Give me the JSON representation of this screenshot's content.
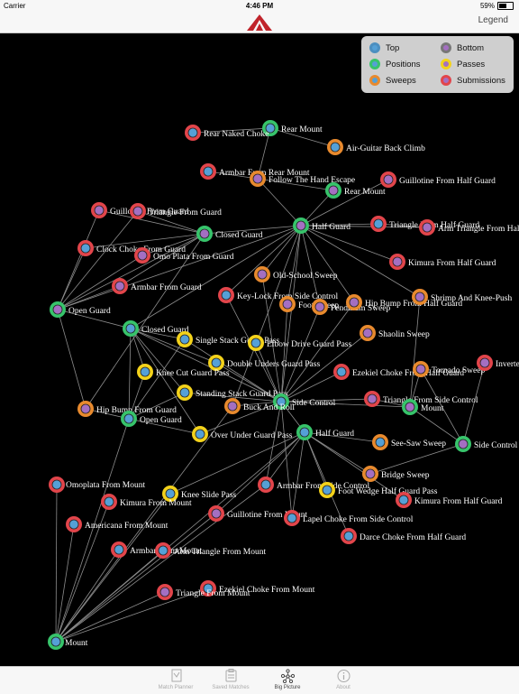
{
  "status_bar": {
    "carrier": "Carrier",
    "time": "4:46 PM",
    "battery": "59%",
    "battery_level": 0.59
  },
  "nav_bar": {
    "legend_label": "Legend"
  },
  "legend": {
    "items": [
      {
        "label": "Top",
        "fill": "#55a0d6",
        "ring": "#4c8fc0"
      },
      {
        "label": "Bottom",
        "fill": "#a46fc2",
        "ring": "#777"
      },
      {
        "label": "Positions",
        "fill": "#55a0d6",
        "ring": "#37c46b"
      },
      {
        "label": "Passes",
        "fill": "#a46fc2",
        "ring": "#f3d21b"
      },
      {
        "label": "Sweeps",
        "fill": "#55a0d6",
        "ring": "#e88a2e"
      },
      {
        "label": "Submissions",
        "fill": "#a46fc2",
        "ring": "#e2454b"
      }
    ]
  },
  "colors": {
    "top": "#55a0d6",
    "bottom": "#a46fc2",
    "positions": "#37c46b",
    "passes": "#f3d21b",
    "sweeps": "#e88a2e",
    "submissions": "#e2454b",
    "edge": "#8d8d8d",
    "accent": "#c0242b"
  },
  "tabs": [
    {
      "label": "Match Planner",
      "icon": "match-planner-icon"
    },
    {
      "label": "Saved Matches",
      "icon": "saved-matches-icon"
    },
    {
      "label": "Big Picture",
      "icon": "big-picture-icon",
      "active": true
    },
    {
      "label": "About",
      "icon": "about-icon"
    }
  ],
  "graph": {
    "nodes": [
      {
        "id": "n01",
        "label": "Rear Mount",
        "kind": "positions",
        "side": "top"
      },
      {
        "id": "n02",
        "label": "Rear Naked Choke",
        "kind": "submissions",
        "side": "top"
      },
      {
        "id": "n03",
        "label": "Air-Guitar Back Climb",
        "kind": "sweeps",
        "side": "top"
      },
      {
        "id": "n04",
        "label": "Armbar From Rear Mount",
        "kind": "submissions",
        "side": "top"
      },
      {
        "id": "n05",
        "label": "Follow The Hand Escape",
        "kind": "sweeps",
        "side": "bottom"
      },
      {
        "id": "n06",
        "label": "Guillotine From Half Guard",
        "kind": "submissions",
        "side": "bottom"
      },
      {
        "id": "n07",
        "label": "Rear Mount",
        "kind": "positions",
        "side": "bottom"
      },
      {
        "id": "n08",
        "label": "Guillotine From Guard",
        "kind": "submissions",
        "side": "bottom"
      },
      {
        "id": "n09",
        "label": "Triangle From Guard",
        "kind": "submissions",
        "side": "bottom"
      },
      {
        "id": "n10",
        "label": "Closed Guard",
        "kind": "positions",
        "side": "bottom"
      },
      {
        "id": "n11",
        "label": "Half Guard",
        "kind": "positions",
        "side": "bottom"
      },
      {
        "id": "n12",
        "label": "Triangle From Half Guard",
        "kind": "submissions",
        "side": "top"
      },
      {
        "id": "n13",
        "label": "Arm Triangle From Half Guard",
        "kind": "submissions",
        "side": "bottom"
      },
      {
        "id": "n14",
        "label": "Clock Choke From Guard",
        "kind": "submissions",
        "side": "top"
      },
      {
        "id": "n15",
        "label": "Omo Plata From Guard",
        "kind": "submissions",
        "side": "bottom"
      },
      {
        "id": "n16",
        "label": "Kimura From Half Guard",
        "kind": "submissions",
        "side": "bottom"
      },
      {
        "id": "n17",
        "label": "Old-School Sweep",
        "kind": "sweeps",
        "side": "bottom"
      },
      {
        "id": "n18",
        "label": "Armbar From Guard",
        "kind": "submissions",
        "side": "bottom"
      },
      {
        "id": "n19",
        "label": "Key-Lock From Side Control",
        "kind": "submissions",
        "side": "top"
      },
      {
        "id": "n20",
        "label": "Foot Sweep",
        "kind": "sweeps",
        "side": "bottom"
      },
      {
        "id": "n21",
        "label": "Pendulum Sweep",
        "kind": "sweeps",
        "side": "bottom"
      },
      {
        "id": "n22",
        "label": "Hip Bump From Half Guard",
        "kind": "sweeps",
        "side": "bottom"
      },
      {
        "id": "n23",
        "label": "Shrimp And Knee-Push",
        "kind": "sweeps",
        "side": "bottom"
      },
      {
        "id": "n24",
        "label": "Open Guard",
        "kind": "positions",
        "side": "bottom"
      },
      {
        "id": "n25",
        "label": "Closed Guard",
        "kind": "positions",
        "side": "top"
      },
      {
        "id": "n26",
        "label": "Single Stack Guard Pass",
        "kind": "passes",
        "side": "top"
      },
      {
        "id": "n27",
        "label": "Elbow Drive Guard Pass",
        "kind": "passes",
        "side": "top"
      },
      {
        "id": "n28",
        "label": "Shaolin Sweep",
        "kind": "sweeps",
        "side": "bottom"
      },
      {
        "id": "n29",
        "label": "Double Unders Guard Pass",
        "kind": "passes",
        "side": "top"
      },
      {
        "id": "n30",
        "label": "Knee Cut Guard Pass",
        "kind": "passes",
        "side": "top"
      },
      {
        "id": "n31",
        "label": "Ezekiel Choke From Half Guard",
        "kind": "submissions",
        "side": "top"
      },
      {
        "id": "n32",
        "label": "Tornado Sweep",
        "kind": "sweeps",
        "side": "bottom"
      },
      {
        "id": "n33",
        "label": "Inverted Triangle",
        "kind": "submissions",
        "side": "bottom"
      },
      {
        "id": "n34",
        "label": "Standing Stack Guard Pass",
        "kind": "passes",
        "side": "top"
      },
      {
        "id": "n35",
        "label": "Side Control",
        "kind": "positions",
        "side": "top"
      },
      {
        "id": "n36",
        "label": "Triangle From Side Control",
        "kind": "submissions",
        "side": "bottom"
      },
      {
        "id": "n37",
        "label": "Hip Bump From Guard",
        "kind": "sweeps",
        "side": "bottom"
      },
      {
        "id": "n38",
        "label": "Buck And Roll",
        "kind": "sweeps",
        "side": "bottom"
      },
      {
        "id": "n39",
        "label": "Mount",
        "kind": "positions",
        "side": "bottom"
      },
      {
        "id": "n40",
        "label": "Open Guard",
        "kind": "positions",
        "side": "top"
      },
      {
        "id": "n41",
        "label": "Over Under Guard Pass",
        "kind": "passes",
        "side": "top"
      },
      {
        "id": "n42",
        "label": "Half Guard",
        "kind": "positions",
        "side": "top"
      },
      {
        "id": "n43",
        "label": "See-Saw Sweep",
        "kind": "sweeps",
        "side": "top"
      },
      {
        "id": "n44",
        "label": "Side Control",
        "kind": "positions",
        "side": "bottom"
      },
      {
        "id": "n45",
        "label": "Armbar From Side Control",
        "kind": "submissions",
        "side": "top"
      },
      {
        "id": "n46",
        "label": "Bridge Sweep",
        "kind": "sweeps",
        "side": "bottom"
      },
      {
        "id": "n47",
        "label": "Omoplata From Mount",
        "kind": "submissions",
        "side": "top"
      },
      {
        "id": "n48",
        "label": "Knee Slide Pass",
        "kind": "passes",
        "side": "top"
      },
      {
        "id": "n49",
        "label": "Foot Wedge Half Guard Pass",
        "kind": "passes",
        "side": "top"
      },
      {
        "id": "n50",
        "label": "Kimura From Half Guard",
        "kind": "submissions",
        "side": "top"
      },
      {
        "id": "n51",
        "label": "Kimura From Mount",
        "kind": "submissions",
        "side": "top"
      },
      {
        "id": "n52",
        "label": "Guillotine From Mount",
        "kind": "submissions",
        "side": "bottom"
      },
      {
        "id": "n53",
        "label": "Lapel Choke From Side Control",
        "kind": "submissions",
        "side": "top"
      },
      {
        "id": "n54",
        "label": "Americana From Mount",
        "kind": "submissions",
        "side": "top"
      },
      {
        "id": "n55",
        "label": "Darce Choke From Half Guard",
        "kind": "submissions",
        "side": "top"
      },
      {
        "id": "n56",
        "label": "Armbar From Mount",
        "kind": "submissions",
        "side": "top"
      },
      {
        "id": "n57",
        "label": "Arm Triangle From Mount",
        "kind": "submissions",
        "side": "top"
      },
      {
        "id": "n58",
        "label": "Ezekiel Choke From Mount",
        "kind": "submissions",
        "side": "top"
      },
      {
        "id": "n59",
        "label": "Triangle From Mount",
        "kind": "submissions",
        "side": "bottom"
      },
      {
        "id": "n60",
        "label": "Mount",
        "kind": "positions",
        "side": "top"
      }
    ],
    "edges": [
      [
        "n01",
        "n02"
      ],
      [
        "n01",
        "n03"
      ],
      [
        "n01",
        "n05"
      ],
      [
        "n05",
        "n04"
      ],
      [
        "n05",
        "n07"
      ],
      [
        "n05",
        "n11"
      ],
      [
        "n07",
        "n11"
      ],
      [
        "n11",
        "n06"
      ],
      [
        "n11",
        "n12"
      ],
      [
        "n11",
        "n13"
      ],
      [
        "n11",
        "n16"
      ],
      [
        "n11",
        "n17"
      ],
      [
        "n11",
        "n10"
      ],
      [
        "n11",
        "n19"
      ],
      [
        "n11",
        "n20"
      ],
      [
        "n11",
        "n21"
      ],
      [
        "n11",
        "n22"
      ],
      [
        "n11",
        "n23"
      ],
      [
        "n11",
        "n35"
      ],
      [
        "n11",
        "n38"
      ],
      [
        "n11",
        "n24"
      ],
      [
        "n11",
        "n25"
      ],
      [
        "n12",
        "n13"
      ],
      [
        "n10",
        "n08"
      ],
      [
        "n10",
        "n09"
      ],
      [
        "n10",
        "n14"
      ],
      [
        "n10",
        "n15"
      ],
      [
        "n10",
        "n18"
      ],
      [
        "n10",
        "n24"
      ],
      [
        "n24",
        "n08"
      ],
      [
        "n24",
        "n09"
      ],
      [
        "n24",
        "n14"
      ],
      [
        "n24",
        "n15"
      ],
      [
        "n24",
        "n18"
      ],
      [
        "n24",
        "n25"
      ],
      [
        "n25",
        "n26"
      ],
      [
        "n25",
        "n29"
      ],
      [
        "n25",
        "n30"
      ],
      [
        "n25",
        "n34"
      ],
      [
        "n25",
        "n41"
      ],
      [
        "n25",
        "n40"
      ],
      [
        "n25",
        "n35"
      ],
      [
        "n40",
        "n26"
      ],
      [
        "n40",
        "n30"
      ],
      [
        "n40",
        "n34"
      ],
      [
        "n40",
        "n41"
      ],
      [
        "n40",
        "n37"
      ],
      [
        "n35",
        "n19"
      ],
      [
        "n35",
        "n27"
      ],
      [
        "n35",
        "n28"
      ],
      [
        "n35",
        "n31"
      ],
      [
        "n35",
        "n36"
      ],
      [
        "n35",
        "n38"
      ],
      [
        "n35",
        "n39"
      ],
      [
        "n35",
        "n42"
      ],
      [
        "n35",
        "n45"
      ],
      [
        "n35",
        "n53"
      ],
      [
        "n35",
        "n26"
      ],
      [
        "n35",
        "n29"
      ],
      [
        "n35",
        "n34"
      ],
      [
        "n35",
        "n41"
      ],
      [
        "n35",
        "n22"
      ],
      [
        "n39",
        "n36"
      ],
      [
        "n39",
        "n32"
      ],
      [
        "n39",
        "n44"
      ],
      [
        "n44",
        "n33"
      ],
      [
        "n44",
        "n32"
      ],
      [
        "n44",
        "n46"
      ],
      [
        "n42",
        "n43"
      ],
      [
        "n42",
        "n46"
      ],
      [
        "n42",
        "n49"
      ],
      [
        "n42",
        "n50"
      ],
      [
        "n42",
        "n55"
      ],
      [
        "n42",
        "n53"
      ],
      [
        "n42",
        "n45"
      ],
      [
        "n42",
        "n48"
      ],
      [
        "n42",
        "n52"
      ],
      [
        "n60",
        "n47"
      ],
      [
        "n60",
        "n51"
      ],
      [
        "n60",
        "n54"
      ],
      [
        "n60",
        "n56"
      ],
      [
        "n60",
        "n57"
      ],
      [
        "n60",
        "n58"
      ],
      [
        "n60",
        "n59"
      ],
      [
        "n60",
        "n52"
      ],
      [
        "n60",
        "n48"
      ],
      [
        "n60",
        "n45"
      ],
      [
        "n60",
        "n38"
      ],
      [
        "n60",
        "n40"
      ],
      [
        "n60",
        "n42"
      ],
      [
        "n37",
        "n24"
      ],
      [
        "n37",
        "n10"
      ],
      [
        "n17",
        "n35"
      ],
      [
        "n20",
        "n35"
      ],
      [
        "n23",
        "n39"
      ],
      [
        "n21",
        "n35"
      ]
    ]
  }
}
